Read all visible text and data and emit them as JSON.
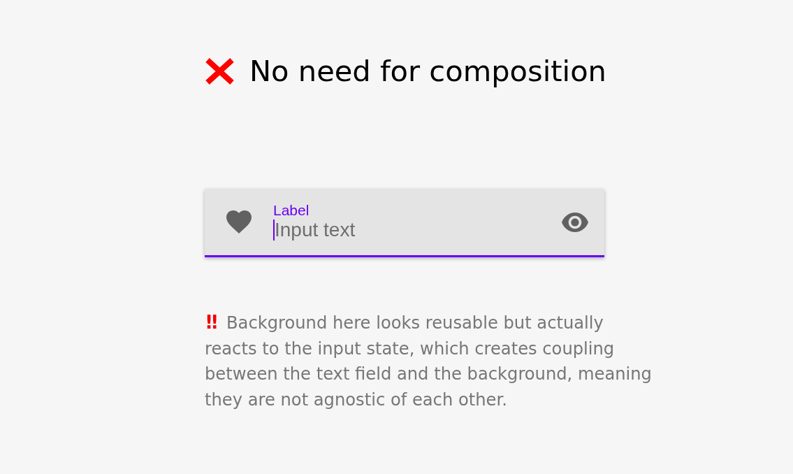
{
  "heading": {
    "text": "No need for composition"
  },
  "text_field": {
    "focused": true,
    "label": "Label",
    "placeholder": "Input text"
  },
  "note": {
    "mark": "‼",
    "text": "Background here looks reusable but actually reacts to the input state, which creates coupling between the text field and the background, meaning they are not agnostic of each other."
  }
}
